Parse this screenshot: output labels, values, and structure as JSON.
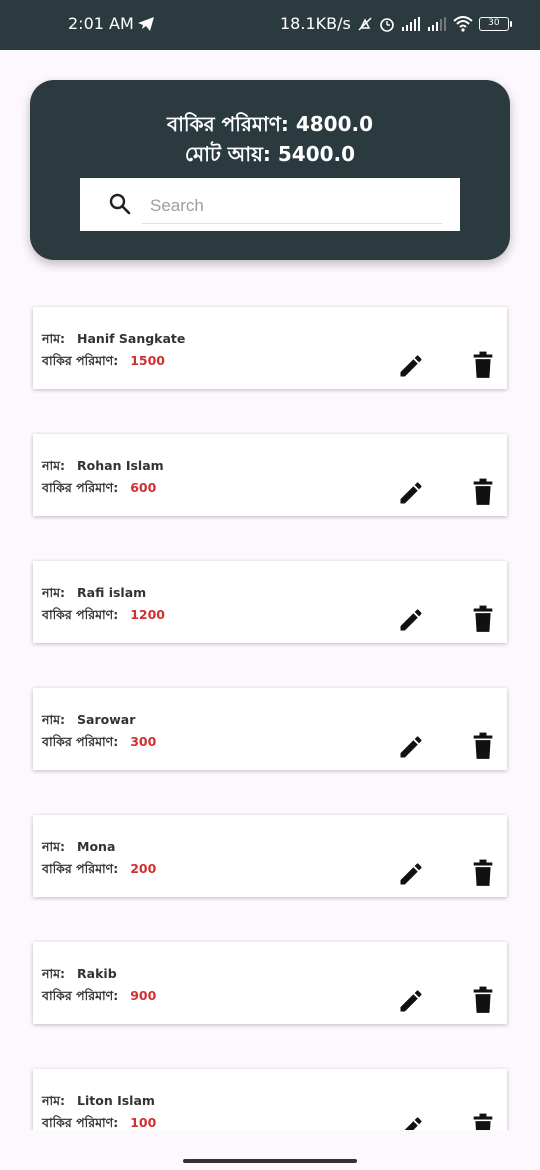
{
  "status_bar": {
    "time": "2:01 AM",
    "network_speed": "18.1KB/s",
    "battery_level": "30"
  },
  "header": {
    "due_total_label": "বাকির পরিমাণ: 4800.0",
    "income_total_label": "মোট আয়: 5400.0"
  },
  "search": {
    "placeholder": "Search",
    "value": ""
  },
  "labels": {
    "name": "নাম:",
    "due_amount": "বাকির পরিমাণ:"
  },
  "customers": [
    {
      "name": "Hanif Sangkate",
      "due": "1500"
    },
    {
      "name": "Rohan Islam",
      "due": "600"
    },
    {
      "name": "Rafi islam",
      "due": "1200"
    },
    {
      "name": "Sarowar",
      "due": "300"
    },
    {
      "name": "Mona",
      "due": "200"
    },
    {
      "name": "Rakib",
      "due": "900"
    },
    {
      "name": "Liton Islam",
      "due": "100"
    }
  ],
  "colors": {
    "header_bg": "#2b3a3e",
    "due_value": "#d32f2f",
    "page_bg": "#fdf8fd"
  },
  "icons": {
    "search": "search-icon",
    "edit": "pencil-icon",
    "delete": "trash-icon"
  }
}
